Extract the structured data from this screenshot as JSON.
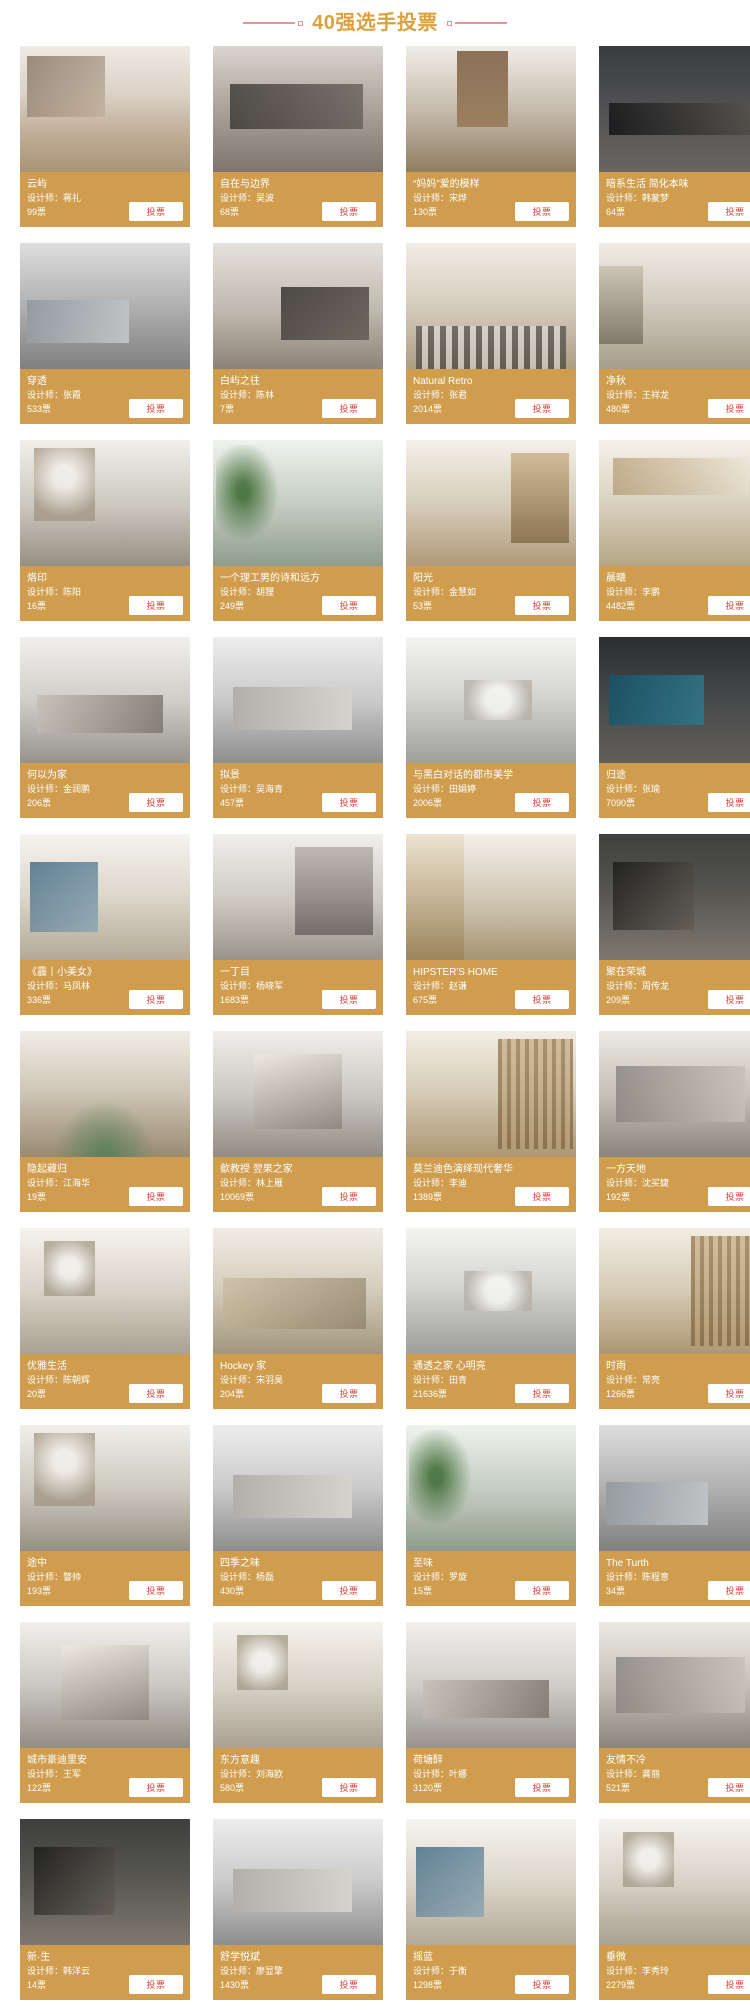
{
  "header": {
    "title": "40强选手投票",
    "accent_color": "#d9a23f",
    "rule_color": "#e8949b"
  },
  "ui": {
    "vote_button_label": "投票",
    "designer_prefix": "设计师：",
    "votes_suffix": "票",
    "card_bg_color": "#cf9d4d",
    "vote_text_color": "#d9453d"
  },
  "cards": [
    {
      "title": "云屿",
      "designer": "设计师：蒋礼",
      "votes": "99票",
      "vote": "投票",
      "ph": "ph-a"
    },
    {
      "title": "自在与边界",
      "designer": "设计师：吴波",
      "votes": "68票",
      "vote": "投票",
      "ph": "ph-b"
    },
    {
      "title": "“妈妈”爱的模样",
      "designer": "设计师：宋烨",
      "votes": "130票",
      "vote": "投票",
      "ph": "ph-c"
    },
    {
      "title": "暗系生活 简化本味",
      "designer": "设计师：韩蒙梦",
      "votes": "64票",
      "vote": "投票",
      "ph": "ph-d"
    },
    {
      "title": "穿透",
      "designer": "设计师：张霞",
      "votes": "533票",
      "vote": "投票",
      "ph": "ph-e"
    },
    {
      "title": "白屿之往",
      "designer": "设计师：陈林",
      "votes": "7票",
      "vote": "投票",
      "ph": "ph-f"
    },
    {
      "title": "Natural Retro",
      "designer": "设计师：张君",
      "votes": "2014票",
      "vote": "投票",
      "ph": "ph-g"
    },
    {
      "title": "净秋",
      "designer": "设计师：王祥龙",
      "votes": "480票",
      "vote": "投票",
      "ph": "ph-h"
    },
    {
      "title": "烙印",
      "designer": "设计师：陈阳",
      "votes": "16票",
      "vote": "投票",
      "ph": "ph-i"
    },
    {
      "title": "一个理工男的诗和远方",
      "designer": "设计师：胡狸",
      "votes": "249票",
      "vote": "投票",
      "ph": "ph-j"
    },
    {
      "title": "阳光",
      "designer": "设计师：金慧如",
      "votes": "53票",
      "vote": "投票",
      "ph": "ph-k"
    },
    {
      "title": "晨曦",
      "designer": "设计师：李鹏",
      "votes": "4482票",
      "vote": "投票",
      "ph": "ph-l"
    },
    {
      "title": "何以为家",
      "designer": "设计师：金润鹏",
      "votes": "206票",
      "vote": "投票",
      "ph": "ph-m"
    },
    {
      "title": "拟景",
      "designer": "设计师：吴海青",
      "votes": "457票",
      "vote": "投票",
      "ph": "ph-n"
    },
    {
      "title": "与黑白对话的都市美学",
      "designer": "设计师：田娟婷",
      "votes": "2006票",
      "vote": "投票",
      "ph": "ph-o"
    },
    {
      "title": "归途",
      "designer": "设计师：张瑜",
      "votes": "7090票",
      "vote": "投票",
      "ph": "ph-p"
    },
    {
      "title": "《霾丨小美女》",
      "designer": "设计师：马凤林",
      "votes": "336票",
      "vote": "投票",
      "ph": "ph-q"
    },
    {
      "title": "一丁目",
      "designer": "设计师：杨晓军",
      "votes": "1683票",
      "vote": "投票",
      "ph": "ph-r"
    },
    {
      "title": "HIPSTER'S HOME",
      "designer": "设计师：赵谦",
      "votes": "675票",
      "vote": "投票",
      "ph": "ph-s"
    },
    {
      "title": "聚在荣城",
      "designer": "设计师：周传龙",
      "votes": "209票",
      "vote": "投票",
      "ph": "ph-t"
    },
    {
      "title": "隐起藏归",
      "designer": "设计师：江海华",
      "votes": "19票",
      "vote": "投票",
      "ph": "ph-u"
    },
    {
      "title": "歙教授 翌果之家",
      "designer": "设计师：林上雁",
      "votes": "10069票",
      "vote": "投票",
      "ph": "ph-v"
    },
    {
      "title": "莫兰迪色演绎现代奢华",
      "designer": "设计师：李迪",
      "votes": "1389票",
      "vote": "投票",
      "ph": "ph-w"
    },
    {
      "title": "一方天地",
      "designer": "设计师：沈买婕",
      "votes": "192票",
      "vote": "投票",
      "ph": "ph-x"
    },
    {
      "title": "优雅生活",
      "designer": "设计师：陈朝辉",
      "votes": "20票",
      "vote": "投票",
      "ph": "ph-y"
    },
    {
      "title": "Hockey 家",
      "designer": "设计师：宋羽昊",
      "votes": "204票",
      "vote": "投票",
      "ph": "ph-z"
    },
    {
      "title": "通透之家 心明亮",
      "designer": "设计师：田青",
      "votes": "21636票",
      "vote": "投票",
      "ph": "ph-o"
    },
    {
      "title": "时雨",
      "designer": "设计师：常亮",
      "votes": "1266票",
      "vote": "投票",
      "ph": "ph-w"
    },
    {
      "title": "途中",
      "designer": "设计师：瞥帅",
      "votes": "193票",
      "vote": "投票",
      "ph": "ph-i"
    },
    {
      "title": "四季之味",
      "designer": "设计师：杨磊",
      "votes": "430票",
      "vote": "投票",
      "ph": "ph-n"
    },
    {
      "title": "至味",
      "designer": "设计师：罗旋",
      "votes": "15票",
      "vote": "投票",
      "ph": "ph-j"
    },
    {
      "title": "The Turth",
      "designer": "设计师：陈程意",
      "votes": "34票",
      "vote": "投票",
      "ph": "ph-e"
    },
    {
      "title": "城市豪迪里安",
      "designer": "设计师：王军",
      "votes": "122票",
      "vote": "投票",
      "ph": "ph-v"
    },
    {
      "title": "东方意趣",
      "designer": "设计师：刘海欧",
      "votes": "580票",
      "vote": "投票",
      "ph": "ph-y"
    },
    {
      "title": "荷塘醉",
      "designer": "设计师：叶娜",
      "votes": "3120票",
      "vote": "投票",
      "ph": "ph-m"
    },
    {
      "title": "友情不冷",
      "designer": "设计师：龚丽",
      "votes": "521票",
      "vote": "投票",
      "ph": "ph-x"
    },
    {
      "title": "新·生",
      "designer": "设计师：韩洋云",
      "votes": "14票",
      "vote": "投票",
      "ph": "ph-t"
    },
    {
      "title": "舒学悦斌",
      "designer": "设计师：廖显擎",
      "votes": "1430票",
      "vote": "投票",
      "ph": "ph-n"
    },
    {
      "title": "摇蓝",
      "designer": "设计师：于衡",
      "votes": "1298票",
      "vote": "投票",
      "ph": "ph-q"
    },
    {
      "title": "垂微",
      "designer": "设计师：李秀玲",
      "votes": "2279票",
      "vote": "投票",
      "ph": "ph-y"
    }
  ]
}
